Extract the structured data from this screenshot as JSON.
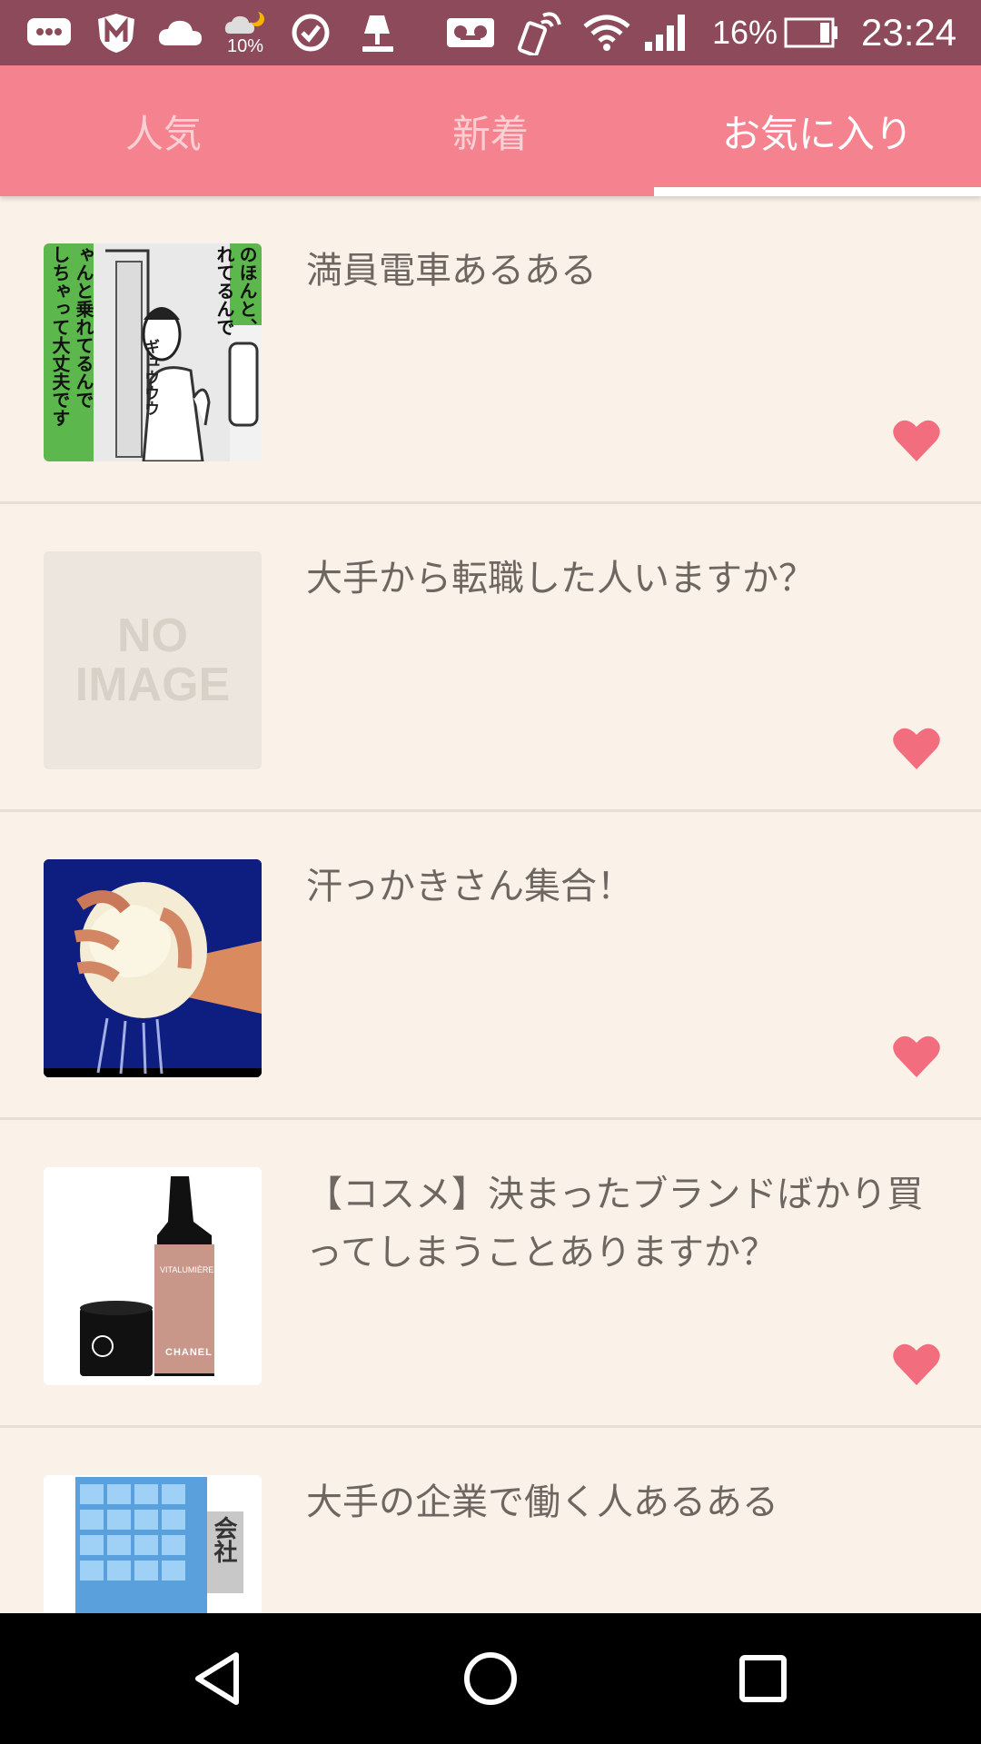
{
  "status_bar": {
    "battery_percent": "16%",
    "time": "23:24",
    "weather_badge": "10%",
    "icons": [
      "message-icon",
      "mcafee-shield-icon",
      "cloud-icon",
      "weather-night-icon",
      "check-circle-icon",
      "lamp-icon",
      "voicemail-icon",
      "nfc-icon",
      "wifi-icon",
      "signal-icon",
      "battery-icon"
    ]
  },
  "tabs": [
    {
      "label": "人気",
      "active": false
    },
    {
      "label": "新着",
      "active": false
    },
    {
      "label": "お気に入り",
      "active": true
    }
  ],
  "items": [
    {
      "title": "満員電車あるある",
      "thumbnail": "manga-train-image",
      "favorited": true
    },
    {
      "title": "大手から転職した人いますか？",
      "thumbnail": "no-image-placeholder",
      "placeholder_text": [
        "NO",
        "IMAGE"
      ],
      "favorited": true
    },
    {
      "title": "汗っかきさん集合！",
      "thumbnail": "hand-squeezing-towel-image",
      "favorited": true
    },
    {
      "title": "【コスメ】決まったブランドばかり買ってしまうことありますか？",
      "thumbnail": "foundation-bottle-image",
      "product_brand": "CHANEL",
      "product_name": "VITALUMIÈRE",
      "favorited": true
    },
    {
      "title": "大手の企業で働く人あるある",
      "thumbnail": "office-building-image",
      "building_sign": "会社",
      "favorited": false
    }
  ],
  "manga_text": {
    "col1": "しちゃって大丈夫です",
    "col2": "ゃんと乗れてるんで",
    "col3": "れてるんで",
    "col4": "のほんと、",
    "sfx": "ギュウウウ"
  },
  "colors": {
    "status_bar": "#8c4a5a",
    "header": "#f5838f",
    "background": "#faf1e8",
    "heart": "#f26d7d",
    "nav_bar": "#000000"
  },
  "nav": {
    "buttons": [
      "back-icon",
      "home-icon",
      "recents-icon"
    ]
  }
}
